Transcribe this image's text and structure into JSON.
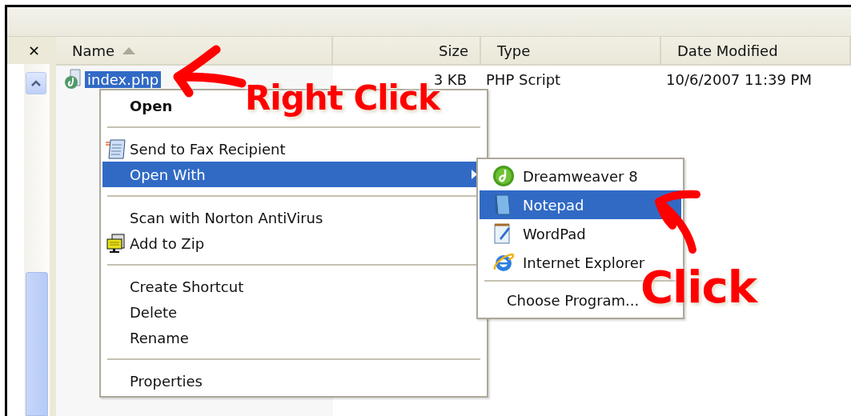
{
  "close_glyph": "✕",
  "columns": [
    {
      "label": "Name",
      "sorted": true
    },
    {
      "label": "Size",
      "sorted": false
    },
    {
      "label": "Type",
      "sorted": false
    },
    {
      "label": "Date Modified",
      "sorted": false
    }
  ],
  "files": [
    {
      "name": "index.php",
      "size": "3 KB",
      "type": "PHP Script",
      "date": "10/6/2007 11:39 PM",
      "selected": true
    }
  ],
  "context_menu": [
    {
      "kind": "item",
      "label": "Open",
      "default": true,
      "selected": false,
      "submenu": false
    },
    {
      "kind": "separator"
    },
    {
      "kind": "item",
      "label": "Send to Fax Recipient",
      "default": false,
      "selected": false,
      "submenu": false
    },
    {
      "kind": "item",
      "label": "Open With",
      "default": false,
      "selected": true,
      "submenu": true
    },
    {
      "kind": "separator"
    },
    {
      "kind": "item",
      "label": "Scan with Norton AntiVirus",
      "default": false,
      "selected": false,
      "submenu": false
    },
    {
      "kind": "item",
      "label": "Add to Zip",
      "default": false,
      "selected": false,
      "submenu": false
    },
    {
      "kind": "separator"
    },
    {
      "kind": "item",
      "label": "Create Shortcut",
      "default": false,
      "selected": false,
      "submenu": false
    },
    {
      "kind": "item",
      "label": "Delete",
      "default": false,
      "selected": false,
      "submenu": false
    },
    {
      "kind": "item",
      "label": "Rename",
      "default": false,
      "selected": false,
      "submenu": false
    },
    {
      "kind": "separator"
    },
    {
      "kind": "item",
      "label": "Properties",
      "default": false,
      "selected": false,
      "submenu": false
    }
  ],
  "submenu": [
    {
      "kind": "item",
      "label": "Dreamweaver 8",
      "selected": false
    },
    {
      "kind": "item",
      "label": "Notepad",
      "selected": true
    },
    {
      "kind": "item",
      "label": "WordPad",
      "selected": false
    },
    {
      "kind": "item",
      "label": "Internet Explorer",
      "selected": false
    },
    {
      "kind": "separator"
    },
    {
      "kind": "item",
      "label": "Choose Program...",
      "selected": false
    }
  ],
  "annotations": [
    {
      "text": "Right Click"
    },
    {
      "text": "Click"
    }
  ]
}
